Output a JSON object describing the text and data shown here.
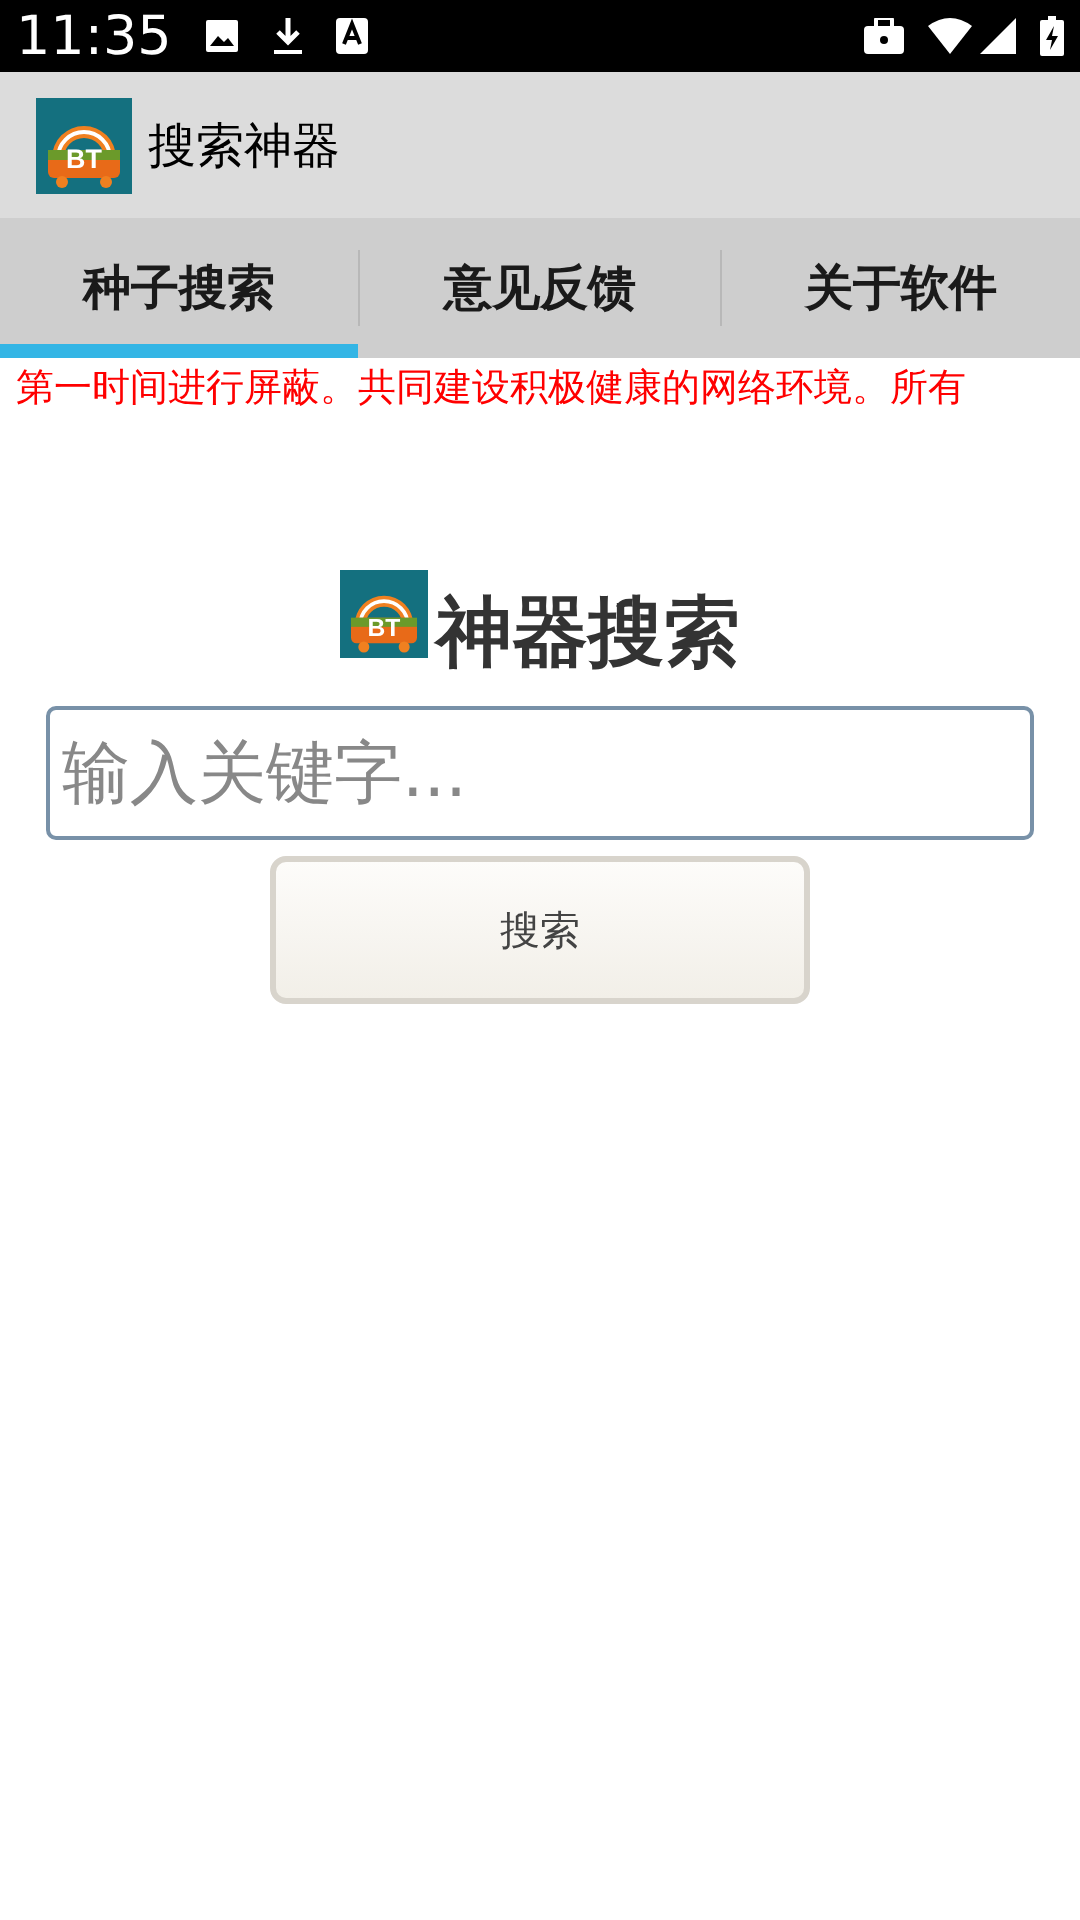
{
  "status_bar": {
    "time": "11:35"
  },
  "app_bar": {
    "logo_text": "BT",
    "title": "搜索神器"
  },
  "tabs": [
    {
      "label": "种子搜索",
      "selected": true
    },
    {
      "label": "意见反馈",
      "selected": false
    },
    {
      "label": "关于软件",
      "selected": false
    }
  ],
  "notice": "第一时间进行屏蔽。共同建设积极健康的网络环境。所有",
  "heading": {
    "logo_text": "BT",
    "title": "神器搜索"
  },
  "search": {
    "placeholder": "输入关键字..."
  },
  "search_button": "搜索"
}
